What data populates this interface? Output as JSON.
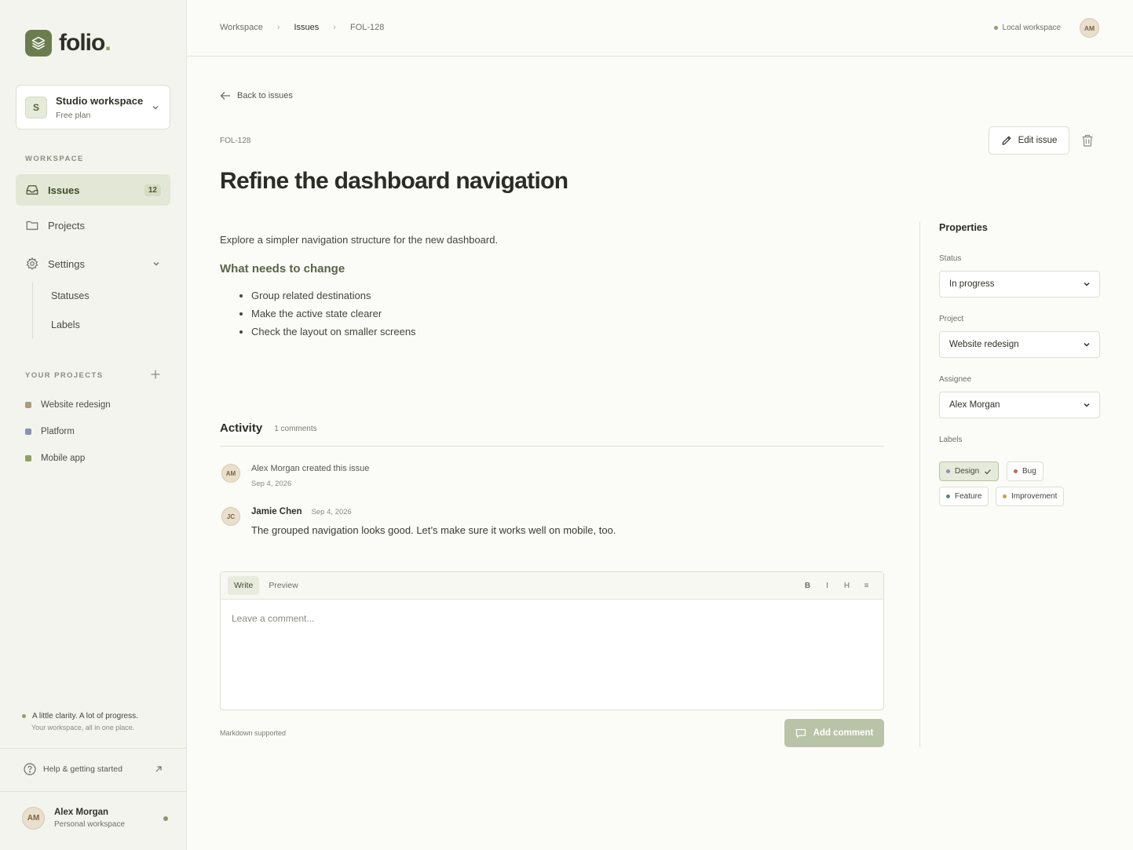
{
  "app": {
    "logo_text": "folio",
    "logo_dot": ".",
    "brand_color": "#6b7d4f"
  },
  "workspace": {
    "initial": "S",
    "name": "Studio workspace",
    "plan": "Free plan"
  },
  "sidebar": {
    "workspace_label": "WORKSPACE",
    "nav": [
      {
        "label": "Issues",
        "count": "12",
        "icon": "inbox-icon",
        "active": true
      },
      {
        "label": "Projects",
        "icon": "folder-icon"
      },
      {
        "label": "Settings",
        "icon": "gear-icon"
      }
    ],
    "settings_sub": [
      "Statuses",
      "Labels"
    ],
    "projects_label": "YOUR PROJECTS",
    "projects": [
      {
        "name": "Website redesign",
        "color": "#a99a80"
      },
      {
        "name": "Platform",
        "color": "#8b8fb8"
      },
      {
        "name": "Mobile app",
        "color": "#8ea163"
      }
    ],
    "tagline": "A little clarity. A lot of progress.",
    "tagline_sub": "Your workspace, all in one place.",
    "help": "Help & getting started",
    "user": {
      "initials": "AM",
      "name": "Alex Morgan",
      "sub": "Personal workspace"
    }
  },
  "topbar": {
    "breadcrumbs": [
      "Workspace",
      "Issues",
      "FOL-128"
    ],
    "local_ws": "Local workspace",
    "avatar": "AM"
  },
  "issue": {
    "back": "Back to issues",
    "key": "FOL-128",
    "title": "Refine the dashboard navigation",
    "edit": "Edit issue",
    "description": "Explore a simpler navigation structure for the new dashboard.",
    "subheading": "What needs to change",
    "bullets": [
      "Group related destinations",
      "Make the active state clearer",
      "Check the layout on smaller screens"
    ]
  },
  "activity": {
    "title": "Activity",
    "count": "1 comments",
    "created": {
      "initials": "AM",
      "text": "Alex Morgan created this issue",
      "date": "Sep 4, 2026"
    },
    "comment": {
      "initials": "JC",
      "author": "Jamie Chen",
      "date": "Sep 4, 2026",
      "text": "The grouped navigation looks good. Let’s make sure it works well on mobile, too."
    }
  },
  "editor": {
    "tabs": [
      "Write",
      "Preview"
    ],
    "format": [
      "B",
      "I",
      "H",
      "≡"
    ],
    "placeholder": "Leave a comment...",
    "note": "Markdown supported",
    "submit": "Add comment"
  },
  "properties": {
    "title": "Properties",
    "status_label": "Status",
    "status": "In progress",
    "project_label": "Project",
    "project": "Website redesign",
    "assignee_label": "Assignee",
    "assignee": "Alex Morgan",
    "labels_label": "Labels",
    "labels": [
      {
        "name": "Design",
        "color": "#9a87c0",
        "selected": true
      },
      {
        "name": "Bug",
        "color": "#c9685a"
      },
      {
        "name": "Feature",
        "color": "#5f8a6e"
      },
      {
        "name": "Improvement",
        "color": "#c4a05a"
      }
    ]
  }
}
